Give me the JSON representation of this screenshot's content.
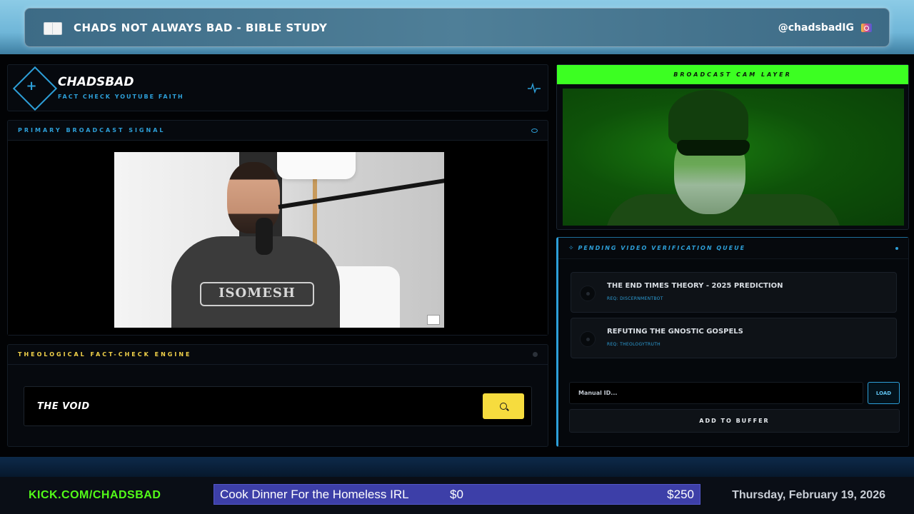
{
  "banner": {
    "title": "CHADS NOT ALWAYS BAD - BIBLE STUDY",
    "handle": "@chadsbadIG",
    "icon": "open-book-icon",
    "handle_icon": "instagram-camera-icon"
  },
  "brand": {
    "name": "CHADSBAD",
    "tagline": "FACT CHECK YOUTUBE FAITH",
    "logo_icon": "diamond-plus-icon",
    "status_icon": "pulse-icon"
  },
  "primary_signal": {
    "label": "PRIMARY BROADCAST SIGNAL",
    "sweater_text": "ISOMESH"
  },
  "fact_check": {
    "label": "THEOLOGICAL FACT-CHECK ENGINE",
    "search_value": "THE VOID",
    "search_icon": "search-icon"
  },
  "cam": {
    "label": "BROADCAST CAM LAYER",
    "accent": "#3cff22"
  },
  "queue": {
    "label": "PENDING VIDEO VERIFICATION QUEUE",
    "items": [
      {
        "title": "THE END TIMES THEORY - 2025 PREDICTION",
        "requester": "REQ: DISCERNMENTBOT"
      },
      {
        "title": "REFUTING THE GNOSTIC GOSPELS",
        "requester": "REQ: THEOLOGYTRUTH"
      }
    ],
    "manual_placeholder": "Manual ID...",
    "load_label": "LOAD",
    "add_label": "ADD TO BUFFER"
  },
  "footer": {
    "channel": "KICK.COM/CHADSBAD",
    "goal_name": "Cook Dinner For the Homeless IRL",
    "goal_current": "$0",
    "goal_target": "$250",
    "date": "Thursday, February 19, 2026"
  },
  "colors": {
    "accent_blue": "#2d9fd8",
    "accent_yellow": "#f6dc3e",
    "kick_green": "#53fc18",
    "goal_bar": "#3d3fa8"
  }
}
